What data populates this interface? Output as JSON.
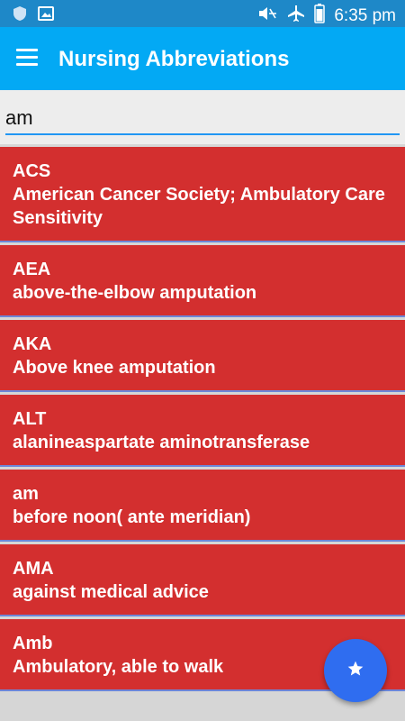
{
  "status_bar": {
    "time": "6:35 pm",
    "icons": [
      "shield-icon",
      "image-icon",
      "mute-icon",
      "airplane-icon",
      "battery-icon"
    ]
  },
  "app_bar": {
    "title": "Nursing Abbreviations",
    "menu_icon": "hamburger-menu-icon",
    "color": "#03a9f4"
  },
  "search": {
    "value": "am",
    "placeholder": ""
  },
  "list": {
    "item_color": "#d32f2f",
    "items": [
      {
        "abbr": "ACS",
        "meaning": "American Cancer Society; Ambulatory Care Sensitivity"
      },
      {
        "abbr": "AEA",
        "meaning": "above-the-elbow amputation"
      },
      {
        "abbr": "AKA",
        "meaning": "Above knee amputation"
      },
      {
        "abbr": "ALT",
        "meaning": "alanineaspartate aminotransferase"
      },
      {
        "abbr": "am",
        "meaning": "before noon( ante meridian)"
      },
      {
        "abbr": "AMA",
        "meaning": "against medical advice"
      },
      {
        "abbr": "Amb",
        "meaning": "Ambulatory, able to walk"
      }
    ]
  },
  "fab": {
    "icon": "star-icon",
    "color": "#2f6df0"
  }
}
